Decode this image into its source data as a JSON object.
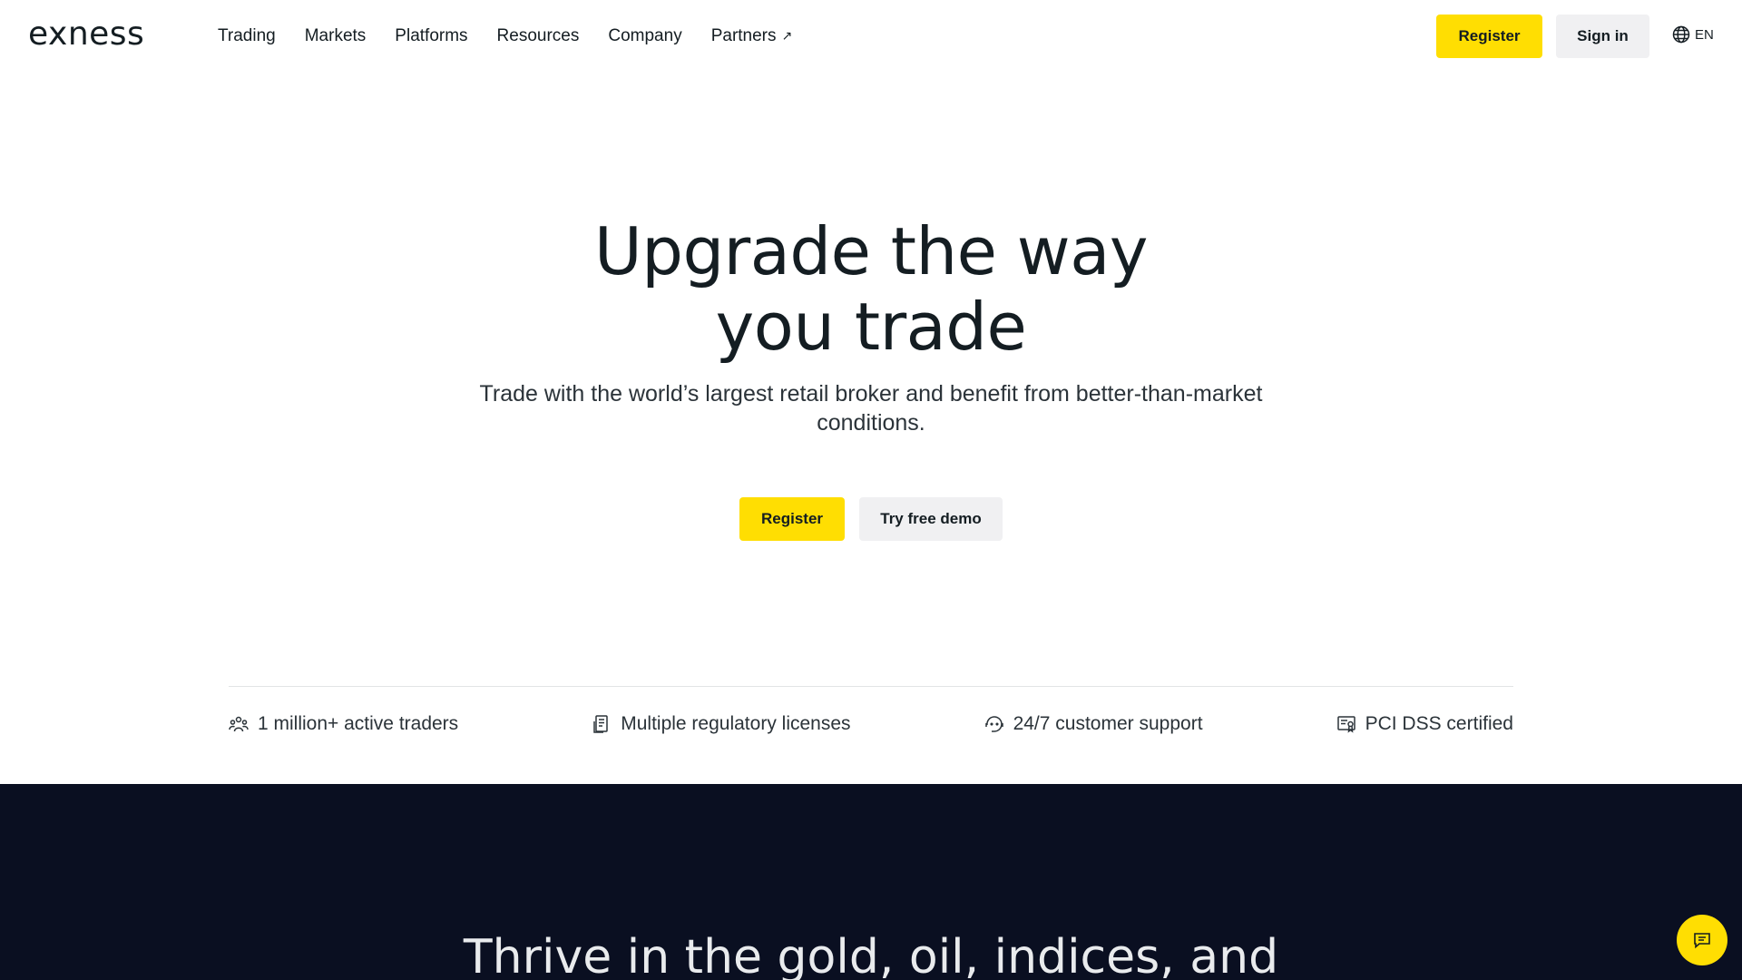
{
  "header": {
    "logo_text": "exness",
    "nav": [
      {
        "label": "Trading"
      },
      {
        "label": "Markets"
      },
      {
        "label": "Platforms"
      },
      {
        "label": "Resources"
      },
      {
        "label": "Company"
      },
      {
        "label": "Partners"
      }
    ],
    "partners_arrow": "↗",
    "register_label": "Register",
    "signin_label": "Sign in",
    "language": "EN"
  },
  "hero": {
    "title_line1": "Upgrade the way",
    "title_line2": "you trade",
    "subtitle": "Trade with the world’s largest retail broker and benefit from better-than-market conditions.",
    "register_label": "Register",
    "demo_label": "Try free demo"
  },
  "features": [
    {
      "label": "1 million+ active traders",
      "icon": "users-icon"
    },
    {
      "label": "Multiple regulatory licenses",
      "icon": "license-icon"
    },
    {
      "label": "24/7 customer support",
      "icon": "support-icon"
    },
    {
      "label": "PCI DSS certified",
      "icon": "certificate-icon"
    }
  ],
  "dark_section": {
    "title": "Thrive in the gold, oil, indices, and"
  },
  "colors": {
    "accent_yellow": "#ffde02",
    "dark_bg": "#0a0f21",
    "text": "#141d22"
  }
}
